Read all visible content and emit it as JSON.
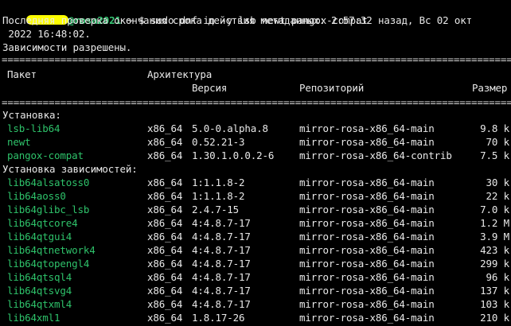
{
  "prompt": {
    "user_suffix": "@rosa2021",
    "path": "~",
    "symbol": "$",
    "command": "sudo dnf in -y lsb newt pangox-compat"
  },
  "messages": {
    "metadata_1": "Последняя проверка окончания срока действия метаданных: 2:57:32 назад, Вс 02 окт",
    "metadata_2": " 2022 16:48:02.",
    "deps_resolved": "Зависимости разрешены."
  },
  "rules": {
    "double": "===================================================================================================================",
    "single": "-------------------------------------------------------------------------------------------------------------------"
  },
  "table": {
    "headers": {
      "package": "Пакет",
      "arch": "Архитектура",
      "version": "Версия",
      "repo": "Репозиторий",
      "size": "Размер"
    },
    "install_section": "Установка:",
    "install": [
      {
        "name": "lsb-lib64",
        "arch": "x86_64",
        "version": "5.0-0.alpha.8",
        "repo": "mirror-rosa-x86_64-main",
        "size": "9.8 k"
      },
      {
        "name": "newt",
        "arch": "x86_64",
        "version": "0.52.21-3",
        "repo": "mirror-rosa-x86_64-main",
        "size": "70 k"
      },
      {
        "name": "pangox-compat",
        "arch": "x86_64",
        "version": "1.30.1.0.0.2-6",
        "repo": "mirror-rosa-x86_64-contrib",
        "size": "7.5 k"
      }
    ],
    "deps_section": "Установка зависимостей:",
    "deps": [
      {
        "name": "lib64alsatoss0",
        "arch": "x86_64",
        "version": "1:1.1.8-2",
        "repo": "mirror-rosa-x86_64-main",
        "size": "30 k"
      },
      {
        "name": "lib64aoss0",
        "arch": "x86_64",
        "version": "1:1.1.8-2",
        "repo": "mirror-rosa-x86_64-main",
        "size": "22 k"
      },
      {
        "name": "lib64glibc_lsb",
        "arch": "x86_64",
        "version": "2.4.7-15",
        "repo": "mirror-rosa-x86_64-main",
        "size": "7.0 k"
      },
      {
        "name": "lib64qtcore4",
        "arch": "x86_64",
        "version": "4:4.8.7-17",
        "repo": "mirror-rosa-x86_64-main",
        "size": "1.2 M"
      },
      {
        "name": "lib64qtgui4",
        "arch": "x86_64",
        "version": "4:4.8.7-17",
        "repo": "mirror-rosa-x86_64-main",
        "size": "3.9 M"
      },
      {
        "name": "lib64qtnetwork4",
        "arch": "x86_64",
        "version": "4:4.8.7-17",
        "repo": "mirror-rosa-x86_64-main",
        "size": "423 k"
      },
      {
        "name": "lib64qtopengl4",
        "arch": "x86_64",
        "version": "4:4.8.7-17",
        "repo": "mirror-rosa-x86_64-main",
        "size": "299 k"
      },
      {
        "name": "lib64qtsql4",
        "arch": "x86_64",
        "version": "4:4.8.7-17",
        "repo": "mirror-rosa-x86_64-main",
        "size": "96 k"
      },
      {
        "name": "lib64qtsvg4",
        "arch": "x86_64",
        "version": "4:4.8.7-17",
        "repo": "mirror-rosa-x86_64-main",
        "size": "137 k"
      },
      {
        "name": "lib64qtxml4",
        "arch": "x86_64",
        "version": "4:4.8.7-17",
        "repo": "mirror-rosa-x86_64-main",
        "size": "103 k"
      },
      {
        "name": "lib64xml1",
        "arch": "x86_64",
        "version": "1.8.17-26",
        "repo": "mirror-rosa-x86_64-main",
        "size": "210 k"
      }
    ]
  }
}
